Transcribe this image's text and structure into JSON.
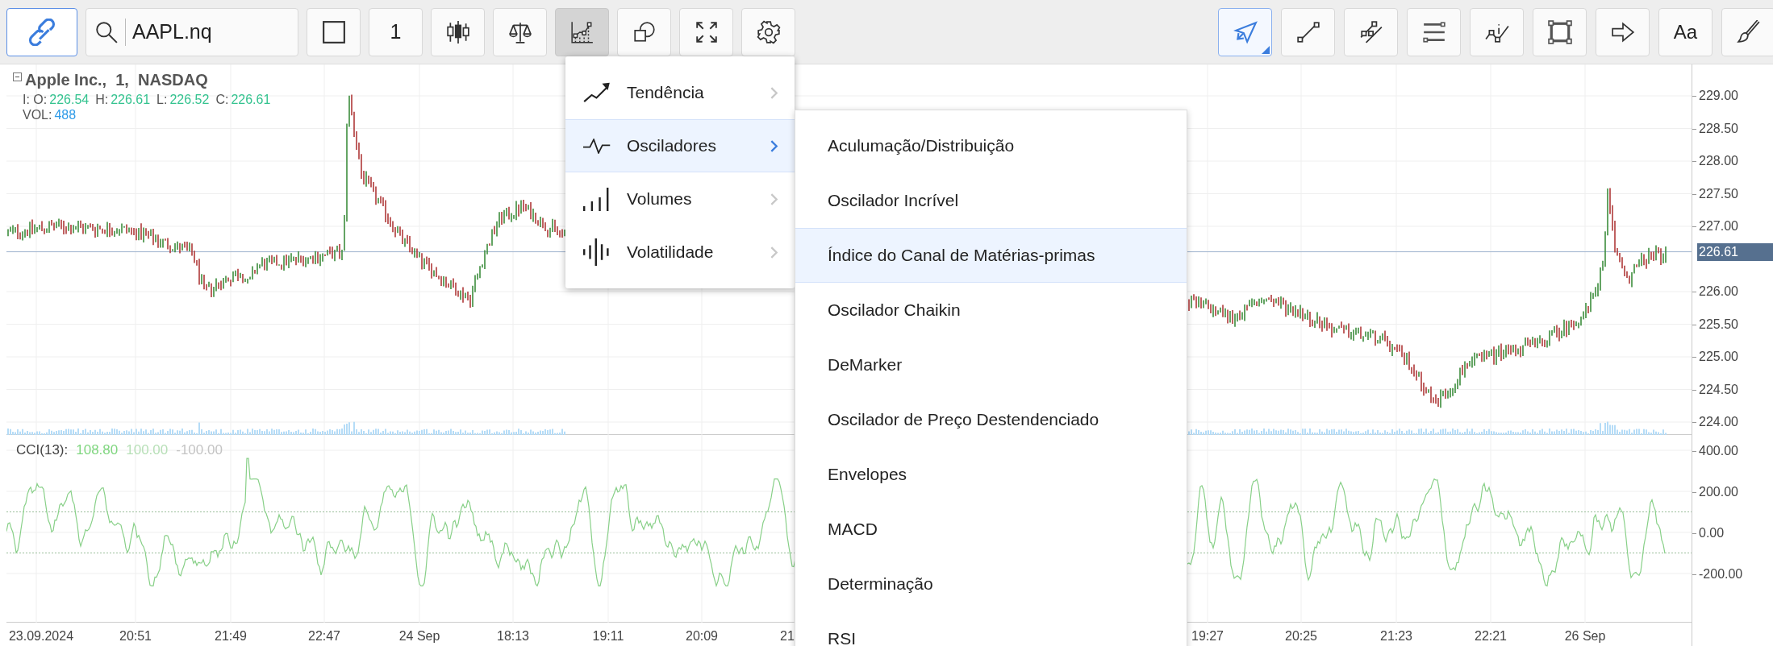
{
  "toolbar_left": [
    {
      "kind": "link",
      "selected": true,
      "open": false
    },
    {
      "kind": "search",
      "value": "AAPL.nq",
      "selected": false,
      "open": false
    },
    {
      "kind": "square",
      "selected": false,
      "open": false
    },
    {
      "kind": "interval",
      "label": "1",
      "selected": false,
      "open": false
    },
    {
      "kind": "candles",
      "selected": false,
      "open": false
    },
    {
      "kind": "scales",
      "selected": false,
      "open": false
    },
    {
      "kind": "indicators",
      "selected": false,
      "open": true
    },
    {
      "kind": "shapes",
      "selected": false,
      "open": false
    },
    {
      "kind": "fullscreen",
      "selected": false,
      "open": false
    },
    {
      "kind": "settings",
      "selected": false,
      "open": false
    }
  ],
  "toolbar_right": [
    {
      "kind": "pointer",
      "selected": true
    },
    {
      "kind": "line",
      "selected": false
    },
    {
      "kind": "parallel",
      "selected": false
    },
    {
      "kind": "levels",
      "selected": false
    },
    {
      "kind": "path-info",
      "selected": false
    },
    {
      "kind": "rectangle",
      "selected": false
    },
    {
      "kind": "arrow",
      "selected": false
    },
    {
      "kind": "text",
      "label": "Aa",
      "selected": false
    },
    {
      "kind": "brush",
      "selected": false
    }
  ],
  "legend": {
    "title": "Apple Inc.,  1,  NASDAQ",
    "ohlc": [
      {
        "label": "I: O:",
        "value": "226.54"
      },
      {
        "label": "H:",
        "value": "226.61"
      },
      {
        "label": "L:",
        "value": "226.52"
      },
      {
        "label": "C:",
        "value": "226.61"
      }
    ],
    "volume": {
      "label": "VOL:",
      "value": "488"
    }
  },
  "price_axis": [
    "229.00",
    "228.50",
    "228.00",
    "227.50",
    "227.00",
    "226.00",
    "225.50",
    "225.00",
    "224.50",
    "224.00"
  ],
  "current_price": "226.61",
  "cci_legend": {
    "label": "CCI(13):",
    "values": [
      {
        "text": "108.80",
        "color": "#7fd67f"
      },
      {
        "text": "100.00",
        "color": "#b8e0b8"
      },
      {
        "text": "-100.00",
        "color": "#c4c4c4"
      }
    ]
  },
  "cci_axis": [
    "400.00",
    "200.00",
    "0.00",
    "-200.00"
  ],
  "time_axis": [
    "23.09.2024",
    "20:51",
    "21:49",
    "22:47",
    "24 Sep",
    "18:13",
    "19:11",
    "20:09",
    "21",
    "19:27",
    "20:25",
    "21:23",
    "22:21",
    "26 Sep"
  ],
  "menu": [
    {
      "kind": "trend",
      "label": "Tendência",
      "selected": false
    },
    {
      "kind": "oscillator",
      "label": "Osciladores",
      "selected": true
    },
    {
      "kind": "volumes",
      "label": "Volumes",
      "selected": false
    },
    {
      "kind": "volatility",
      "label": "Volatilidade",
      "selected": false
    }
  ],
  "submenu": [
    {
      "label": "Aculumação/Distribuição",
      "selected": false
    },
    {
      "label": "Oscilador Incrível",
      "selected": false
    },
    {
      "label": "Índice do Canal de Matérias-primas",
      "selected": true
    },
    {
      "label": "Oscilador Chaikin",
      "selected": false
    },
    {
      "label": "DeMarker",
      "selected": false
    },
    {
      "label": "Oscilador de Preço Destendenciado",
      "selected": false
    },
    {
      "label": "Envelopes",
      "selected": false
    },
    {
      "label": "MACD",
      "selected": false
    },
    {
      "label": "Determinação",
      "selected": false
    },
    {
      "label": "RSI",
      "selected": false
    }
  ]
}
